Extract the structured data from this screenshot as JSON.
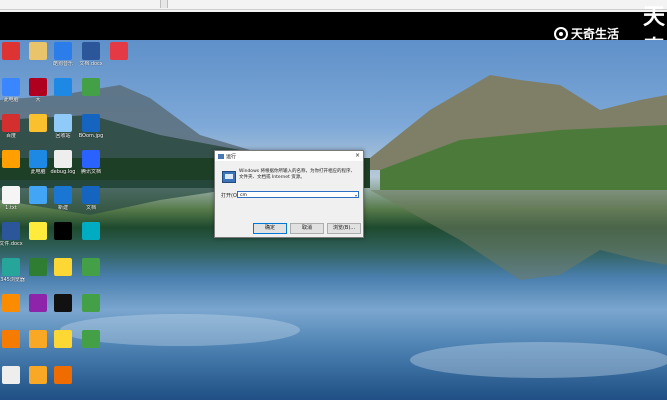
{
  "watermark": {
    "big_text": "天奇",
    "brand": "天奇生活"
  },
  "run_dialog": {
    "title": "运行",
    "description": "Windows 将根据你所输入的名称，为你打开相应的程序、文件夹、文档或 Internet 资源。",
    "open_label": "打开(O):",
    "input_value": "cm",
    "ok_label": "确定",
    "cancel_label": "取消",
    "browse_label": "浏览(B)...",
    "close_glyph": "×"
  },
  "desktop": {
    "icons": [
      {
        "label": "",
        "color": "#d33"
      },
      {
        "label": "",
        "color": "#e9c46a"
      },
      {
        "label": "酷狗音乐",
        "color": "#2b7de9"
      },
      {
        "label": "文档.docx",
        "color": "#2b579a"
      },
      {
        "label": "",
        "color": "#e63946"
      },
      {
        "label": "此电脑",
        "color": "#3a86ff"
      },
      {
        "label": "大",
        "color": "#b00020"
      },
      {
        "label": "",
        "color": "#1e88e5"
      },
      {
        "label": "",
        "color": "#43a047"
      },
      {
        "label": "百度",
        "color": "#d32f2f"
      },
      {
        "label": "",
        "color": "#fbc02d"
      },
      {
        "label": "回收站",
        "color": "#90caf9"
      },
      {
        "label": "BOom.jpg",
        "color": "#1565c0"
      },
      {
        "label": "",
        "color": "#ffa000"
      },
      {
        "label": "此电脑",
        "color": "#1e88e5"
      },
      {
        "label": "debug.log",
        "color": "#eeeeee"
      },
      {
        "label": "腾讯文档",
        "color": "#2962ff"
      },
      {
        "label": "1.txt",
        "color": "#f5f5f5"
      },
      {
        "label": "",
        "color": "#42a5f5"
      },
      {
        "label": "新建",
        "color": "#1976d2"
      },
      {
        "label": "文档",
        "color": "#1565c0"
      },
      {
        "label": "文件.docx",
        "color": "#2b579a"
      },
      {
        "label": "",
        "color": "#ffeb3b"
      },
      {
        "label": "",
        "color": "#000000"
      },
      {
        "label": "",
        "color": "#00acc1"
      },
      {
        "label": "2345浏览器",
        "color": "#26a69a"
      },
      {
        "label": "",
        "color": "#2e7d32"
      },
      {
        "label": "",
        "color": "#fdd835"
      },
      {
        "label": "",
        "color": "#43a047"
      },
      {
        "label": "",
        "color": "#fb8c00"
      },
      {
        "label": "",
        "color": "#8e24aa"
      },
      {
        "label": "",
        "color": "#111111"
      },
      {
        "label": "",
        "color": "#43a047"
      },
      {
        "label": "",
        "color": "#f57c00"
      },
      {
        "label": "",
        "color": "#f9a825"
      },
      {
        "label": "",
        "color": "#fdd835"
      },
      {
        "label": "",
        "color": "#43a047"
      },
      {
        "label": "",
        "color": "#eeeeee"
      },
      {
        "label": "",
        "color": "#f9a825"
      },
      {
        "label": "",
        "color": "#ef6c00"
      },
      {
        "label": "",
        "color": "#1565c0"
      }
    ]
  }
}
